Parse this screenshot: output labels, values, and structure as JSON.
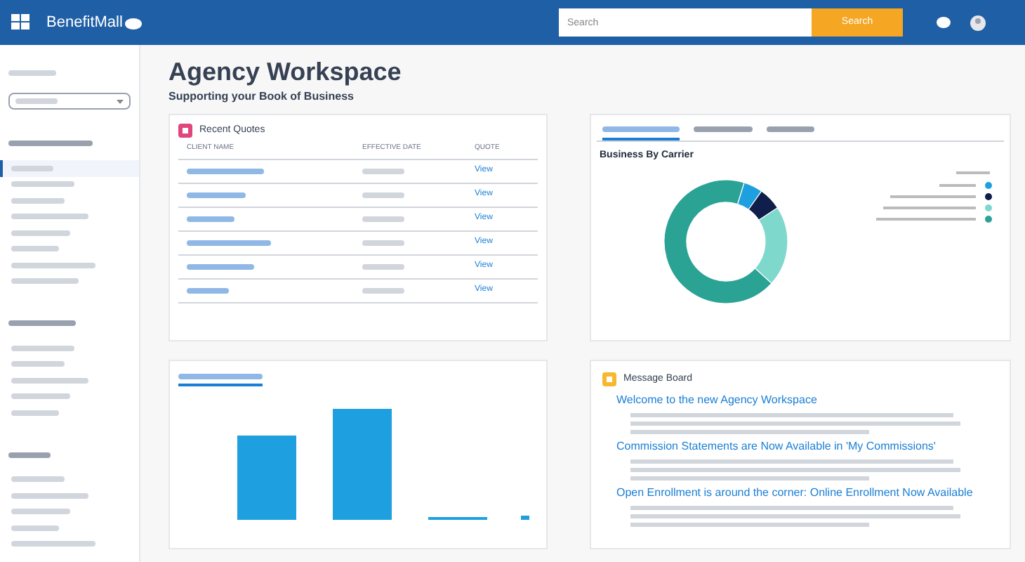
{
  "header": {
    "logo": "BenefitMall",
    "search": {
      "placeholder": "Search"
    },
    "search_button": "Search"
  },
  "sidebar": {
    "groups": [
      {
        "items": [
          {
            "selected": true
          },
          {
            "selected": false
          },
          {
            "selected": false
          },
          {
            "selected": false
          },
          {
            "selected": false
          },
          {
            "selected": false
          },
          {
            "selected": false
          },
          {
            "selected": false
          }
        ]
      },
      {
        "items": [
          {
            "selected": false
          },
          {
            "selected": false
          },
          {
            "selected": false
          },
          {
            "selected": false
          },
          {
            "selected": false
          }
        ]
      },
      {
        "items": [
          {
            "selected": false
          },
          {
            "selected": false
          },
          {
            "selected": false
          },
          {
            "selected": false
          },
          {
            "selected": false
          }
        ]
      }
    ]
  },
  "page": {
    "title": "Agency Workspace",
    "subtitle": "Supporting your Book of Business"
  },
  "quotes": {
    "title": "Recent Quotes",
    "columns": [
      "CLIENT NAME",
      "EFFECTIVE DATE",
      "QUOTE"
    ],
    "rows": [
      {
        "action": "View"
      },
      {
        "action": "View"
      },
      {
        "action": "View"
      },
      {
        "action": "View"
      },
      {
        "action": "View"
      },
      {
        "action": "View"
      }
    ]
  },
  "business": {
    "tabs": [
      {
        "selected": true
      },
      {
        "selected": false
      },
      {
        "selected": false
      }
    ],
    "chart_title": "Business By Carrier"
  },
  "enrollments": {
    "tabs": [
      {
        "selected": true
      }
    ]
  },
  "messages": {
    "title": "Message Board",
    "posts": [
      {
        "title": "Welcome to the new Agency Workspace"
      },
      {
        "title": "Commission Statements are Now Available in 'My Commissions'"
      },
      {
        "title": "Open Enrollment is around the corner: Online Enrollment Now Available"
      }
    ]
  }
}
